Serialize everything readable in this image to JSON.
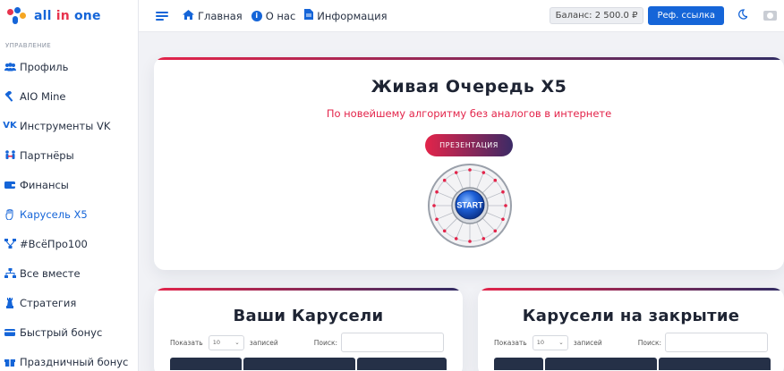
{
  "sidebar": {
    "logo": {
      "part1": "all ",
      "part2": "in",
      "part3": " one"
    },
    "section_label": "УПРАВЛЕНИЕ",
    "items": [
      {
        "label": "Профиль",
        "icon": "users-icon"
      },
      {
        "label": "AIO Mine",
        "icon": "hammer-icon"
      },
      {
        "label": "Инструменты VK",
        "icon": "vk-icon"
      },
      {
        "label": "Партнёры",
        "icon": "partners-icon"
      },
      {
        "label": "Финансы",
        "icon": "wallet-icon"
      },
      {
        "label": "Карусель X5",
        "icon": "hand-icon",
        "active": true
      },
      {
        "label": "#ВсёПро100",
        "icon": "network-icon"
      },
      {
        "label": "Все вместе",
        "icon": "sitemap-icon"
      },
      {
        "label": "Стратегия",
        "icon": "chess-icon"
      },
      {
        "label": "Быстрый бонус",
        "icon": "card-icon"
      },
      {
        "label": "Праздничный бонус",
        "icon": "gift-icon"
      }
    ]
  },
  "topbar": {
    "home": "Главная",
    "about": "О нас",
    "about_badge": "i",
    "info": "Информация",
    "balance": "Баланс: 2 500.0 ₽",
    "ref_button": "Реф. ссылка"
  },
  "hero": {
    "title": "Живая Очередь X5",
    "subtitle": "По новейшему алгоритму без аналогов в интернете",
    "button": "ПРЕЗЕНТАЦИЯ",
    "wheel_label": "START"
  },
  "carousels": {
    "title": "Ваши Карусели",
    "show_label": "Показать",
    "entries_value": "10",
    "entries_label": "записей",
    "search_label": "Поиск:"
  },
  "closing": {
    "title": "Карусели на закрытие",
    "show_label": "Показать",
    "entries_value": "10",
    "entries_label": "записей",
    "search_label": "Поиск:"
  },
  "colors": {
    "accent": "#1565d8",
    "brand_red": "#e3244a",
    "dark": "#253047"
  }
}
